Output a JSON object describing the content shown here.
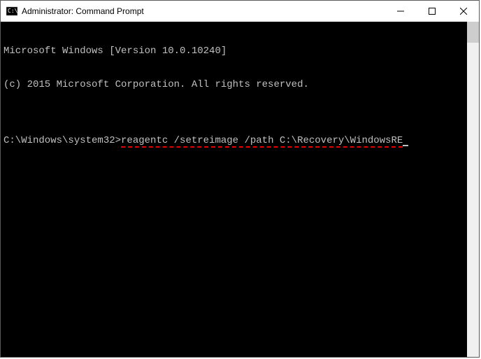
{
  "titlebar": {
    "title": "Administrator: Command Prompt"
  },
  "terminal": {
    "line1": "Microsoft Windows [Version 10.0.10240]",
    "line2": "(c) 2015 Microsoft Corporation. All rights reserved.",
    "blank": "",
    "prompt": "C:\\Windows\\system32>",
    "command": "reagentc /setreimage /path C:\\Recovery\\WindowsRE"
  }
}
